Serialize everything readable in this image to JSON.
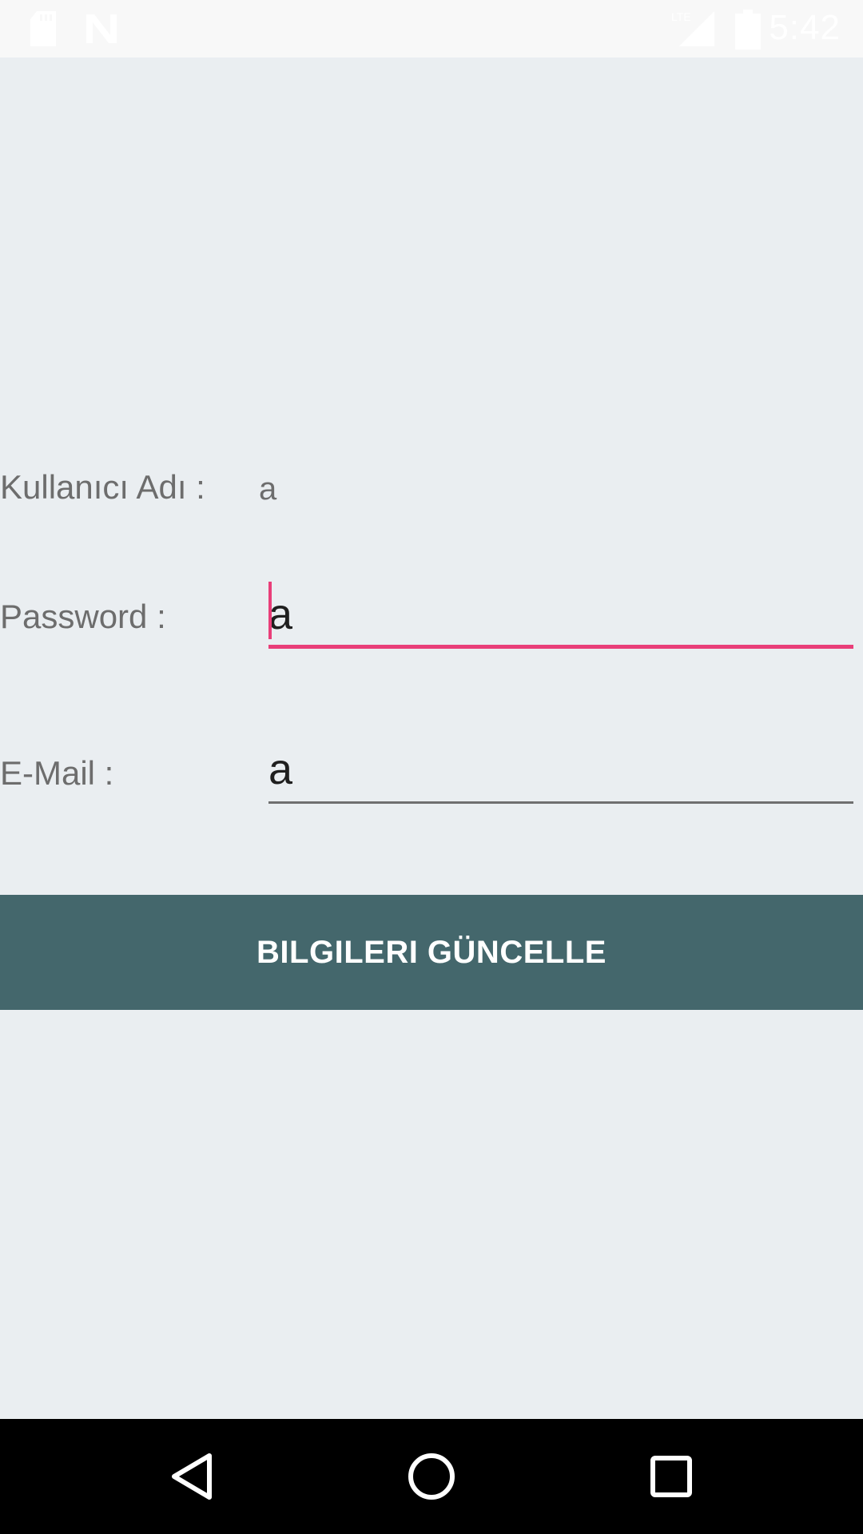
{
  "status_bar": {
    "time": "5:42",
    "network_label": "LTE",
    "icons": [
      "sd-card-icon",
      "no-sim-icon",
      "signal-icon",
      "battery-icon"
    ]
  },
  "form": {
    "username": {
      "label": "Kullanıcı Adı :",
      "value": "a"
    },
    "password": {
      "label": "Password :",
      "value": "a"
    },
    "email": {
      "label": "E-Mail :",
      "value": "a"
    }
  },
  "update_button": {
    "label": "BILGILERI GÜNCELLE"
  },
  "colors": {
    "background": "#eaeef1",
    "accent": "#e93e79",
    "button": "#44676c",
    "label": "#6d6d6d"
  },
  "nav_bar": {
    "icons": [
      "back-icon",
      "home-icon",
      "recents-icon"
    ]
  }
}
